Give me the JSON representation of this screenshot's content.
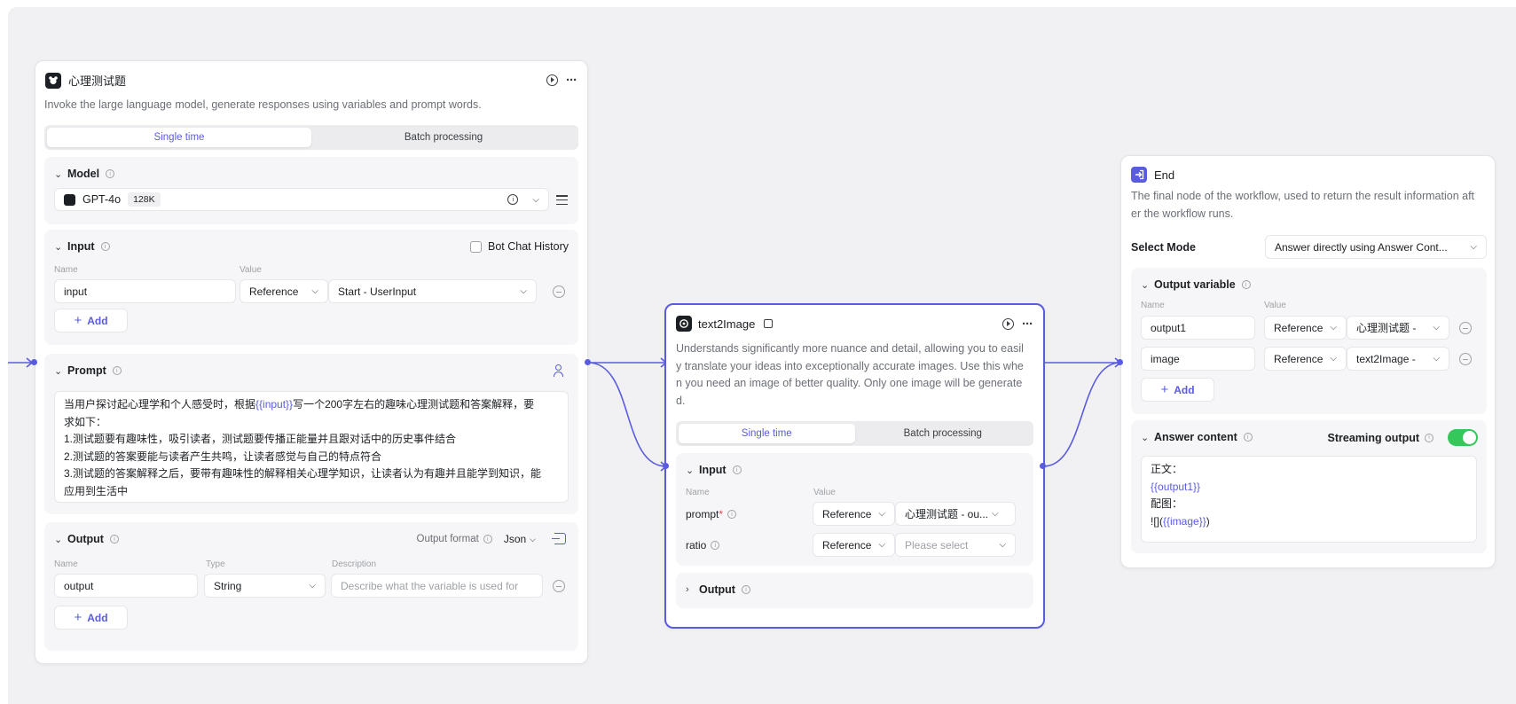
{
  "node1": {
    "title": "心理测试题",
    "description": "Invoke the large language model, generate responses using variables and prompt words.",
    "tabs": [
      "Single time",
      "Batch processing"
    ],
    "model": {
      "section_title": "Model",
      "name": "GPT-4o",
      "context": "128K"
    },
    "input": {
      "section_title": "Input",
      "bot_chat_history": "Bot Chat History",
      "col_name": "Name",
      "col_value": "Value",
      "rows": [
        {
          "name": "input",
          "type": "Reference",
          "value": "Start - UserInput"
        }
      ],
      "add_label": "Add"
    },
    "prompt": {
      "section_title": "Prompt",
      "line1_pre": "当用户探讨起心理学和个人感受时，根据",
      "line1_var": "{{input}}",
      "line1_post": "写一个200字左右的趣味心理测试题和答案解释，要",
      "line2": "求如下：",
      "line3": "1.测试题要有趣味性，吸引读者，测试题要传播正能量并且跟对话中的历史事件结合",
      "line4": "2.测试题的答案要能与读者产生共鸣，让读者感觉与自己的特点符合",
      "line5": "3.测试题的答案解释之后，要带有趣味性的解释相关心理学知识，让读者认为有趣并且能学到知识，能",
      "line6": "应用到生活中"
    },
    "output": {
      "section_title": "Output",
      "format_label": "Output format",
      "format_value": "Json",
      "col_name": "Name",
      "col_type": "Type",
      "col_desc": "Description",
      "rows": [
        {
          "name": "output",
          "type": "String",
          "description_placeholder": "Describe what the variable is used for"
        }
      ],
      "add_label": "Add"
    }
  },
  "node2": {
    "title": "text2Image",
    "description_lines": [
      "Understands significantly more nuance and detail, allowing you to easil",
      "y translate your ideas into exceptionally accurate images. Use this whe",
      "n you need an image of better quality. Only one image will be generate",
      "d."
    ],
    "tabs": [
      "Single time",
      "Batch processing"
    ],
    "input": {
      "section_title": "Input",
      "col_name": "Name",
      "col_value": "Value",
      "rows": [
        {
          "name": "prompt",
          "required": "*",
          "type": "Reference",
          "value": "心理测试题 - ou..."
        },
        {
          "name": "ratio",
          "required": "",
          "type": "Reference",
          "value": "Please select"
        }
      ]
    },
    "output": {
      "section_title": "Output"
    }
  },
  "node3": {
    "title": "End",
    "description_lines": [
      "The final node of the workflow, used to return the result information aft",
      "er the workflow runs."
    ],
    "select_mode_label": "Select Mode",
    "select_mode_value": "Answer directly using Answer Cont...",
    "output_variable": {
      "section_title": "Output variable",
      "col_name": "Name",
      "col_value": "Value",
      "rows": [
        {
          "name": "output1",
          "type": "Reference",
          "value": "心理测试题 -"
        },
        {
          "name": "image",
          "type": "Reference",
          "value": "text2Image -"
        }
      ],
      "add_label": "Add"
    },
    "answer": {
      "section_title": "Answer content",
      "streaming_label": "Streaming output",
      "streaming_on": true,
      "line1": "正文：",
      "line2": "{{output1}}",
      "line3": "配图：",
      "line4_pre": "![](",
      "line4_var": "{{image}}",
      "line4_post": ")"
    }
  },
  "colors": {
    "accent": "#5a5ce0",
    "toggle": "#34c759",
    "canvas": "#f1f1f3"
  }
}
